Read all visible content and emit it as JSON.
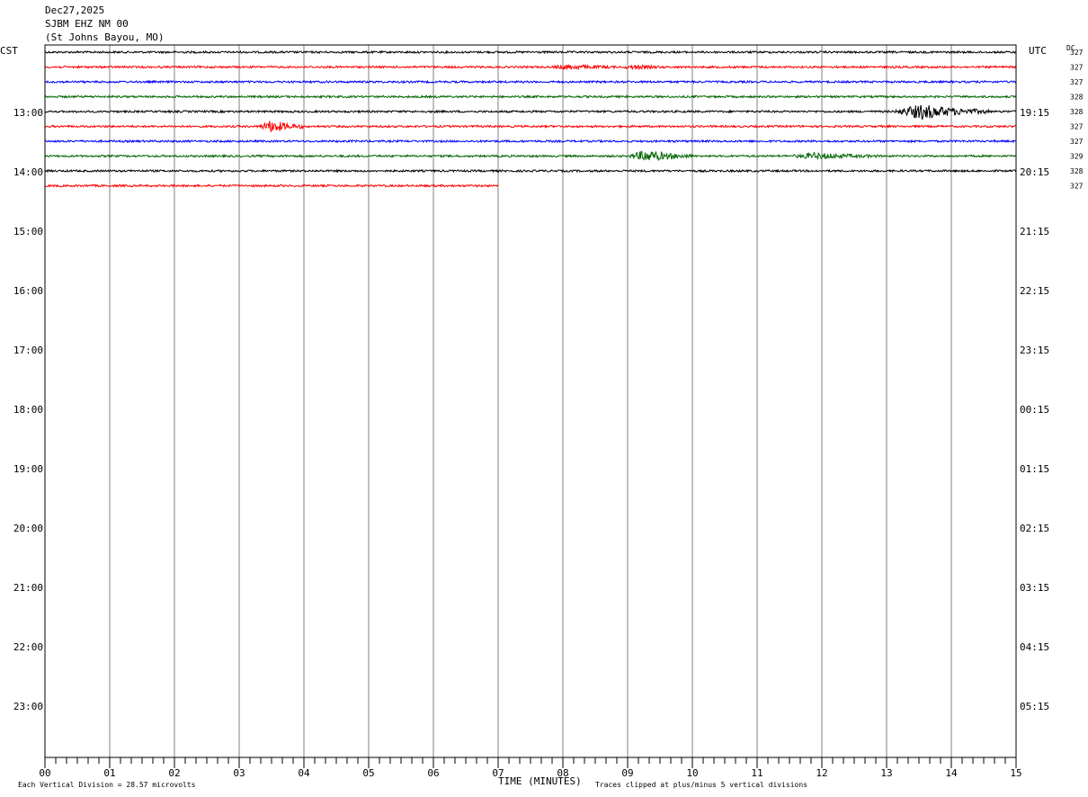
{
  "header": {
    "date": "Dec27,2025",
    "station": "SJBM EHZ NM 00",
    "location": "(St Johns Bayou, MO)"
  },
  "labels": {
    "left_tz": "CST",
    "right_tz": "UTC",
    "dc": "DC",
    "xlabel": "TIME (MINUTES)",
    "vertical_division": "Each Vertical Division =   28.57 microvolts",
    "clipping": "Traces clipped at plus/minus 5 vertical divisions"
  },
  "chart_data": {
    "type": "line",
    "subtype": "helicorder",
    "xlabel": "TIME (MINUTES)",
    "xlim": [
      0,
      15
    ],
    "x_ticks": [
      "00",
      "01",
      "02",
      "03",
      "04",
      "05",
      "06",
      "07",
      "08",
      "09",
      "10",
      "11",
      "12",
      "13",
      "14",
      "15"
    ],
    "left_time_labels": [
      "13:00",
      "14:00",
      "15:00",
      "16:00",
      "17:00",
      "18:00",
      "19:00",
      "20:00",
      "21:00",
      "22:00",
      "23:00"
    ],
    "right_time_labels": [
      "19:15",
      "20:15",
      "21:15",
      "22:15",
      "23:15",
      "00:15",
      "01:15",
      "02:15",
      "03:15",
      "04:15",
      "05:15"
    ],
    "dc_values": [
      "327",
      "327",
      "327",
      "328",
      "328",
      "327",
      "327",
      "329",
      "328",
      "327"
    ],
    "trace_colors": [
      "#000000",
      "#ff0000",
      "#0000ff",
      "#006400"
    ],
    "traces": [
      {
        "index": 0,
        "color": "#000000",
        "end_minute": 15,
        "events": []
      },
      {
        "index": 1,
        "color": "#ff0000",
        "end_minute": 15,
        "events": [
          {
            "start": 7.8,
            "end": 8.8,
            "amp": 2.2
          },
          {
            "start": 8.9,
            "end": 9.6,
            "amp": 1.6
          }
        ]
      },
      {
        "index": 2,
        "color": "#0000ff",
        "end_minute": 15,
        "events": []
      },
      {
        "index": 3,
        "color": "#006400",
        "end_minute": 15,
        "events": []
      },
      {
        "index": 4,
        "color": "#000000",
        "end_minute": 15,
        "events": [
          {
            "start": 13.1,
            "end": 14.6,
            "amp": 8.0
          }
        ]
      },
      {
        "index": 5,
        "color": "#ff0000",
        "end_minute": 15,
        "events": [
          {
            "start": 3.3,
            "end": 4.0,
            "amp": 6.5
          }
        ]
      },
      {
        "index": 6,
        "color": "#0000ff",
        "end_minute": 15,
        "events": []
      },
      {
        "index": 7,
        "color": "#006400",
        "end_minute": 15,
        "events": [
          {
            "start": 9.0,
            "end": 10.0,
            "amp": 6.0
          },
          {
            "start": 11.5,
            "end": 12.9,
            "amp": 3.0
          }
        ]
      },
      {
        "index": 8,
        "color": "#000000",
        "end_minute": 15,
        "events": []
      },
      {
        "index": 9,
        "color": "#ff0000",
        "end_minute": 7,
        "events": []
      }
    ],
    "vertical_division_microvolts": 28.57,
    "clip_divisions": 5,
    "grid": true
  }
}
